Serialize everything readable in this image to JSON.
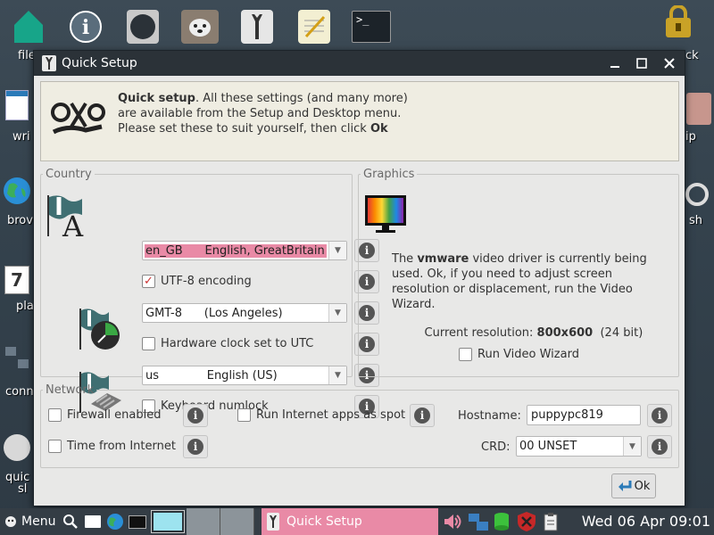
{
  "desktop": {
    "labels": [
      "file",
      "ck",
      "wri",
      "ip",
      "brov",
      "sh",
      "pla",
      "conn",
      "quic",
      "sl"
    ]
  },
  "window": {
    "title": "Quick Setup",
    "intro": {
      "bold": "Quick setup",
      "text": ". All these settings (and many more) are available from the Setup and Desktop menu. Please set these to suit yourself, then click ",
      "ok_word": "Ok"
    },
    "country": {
      "legend": "Country",
      "locale": "en_GB      English, GreatBritain",
      "utf8_label": "UTF-8 encoding",
      "utf8_checked": true,
      "timezone": "GMT-8      (Los Angeles)",
      "hwclock_label": "Hardware clock set to UTC",
      "keyboard": "us             English (US)",
      "numlock_label": "Keyboard numlock"
    },
    "graphics": {
      "legend": "Graphics",
      "desc_pre": "The ",
      "desc_bold": "vmware",
      "desc_post": " video driver is currently being used. Ok, if you need to adjust screen resolution or displacement, run the Video Wizard.",
      "res_label": "Current resolution: ",
      "res_value": "800x600",
      "res_bits": "  (24 bit)",
      "wizard_label": "Run Video Wizard"
    },
    "network": {
      "legend": "Network",
      "firewall_label": "Firewall enabled",
      "spot_label": "Run Internet apps as spot",
      "hostname_label": "Hostname:",
      "hostname_value": "puppypc819",
      "timeinet_label": "Time from Internet",
      "crd_label": "CRD:",
      "crd_value": "00 UNSET"
    },
    "ok_label": "Ok"
  },
  "taskbar": {
    "menu_label": "Menu",
    "task_label": "Quick Setup",
    "clock": "Wed 06 Apr 09:01"
  },
  "colors": {
    "highlight": "#e98aa6",
    "titlebar": "#2b3238"
  }
}
